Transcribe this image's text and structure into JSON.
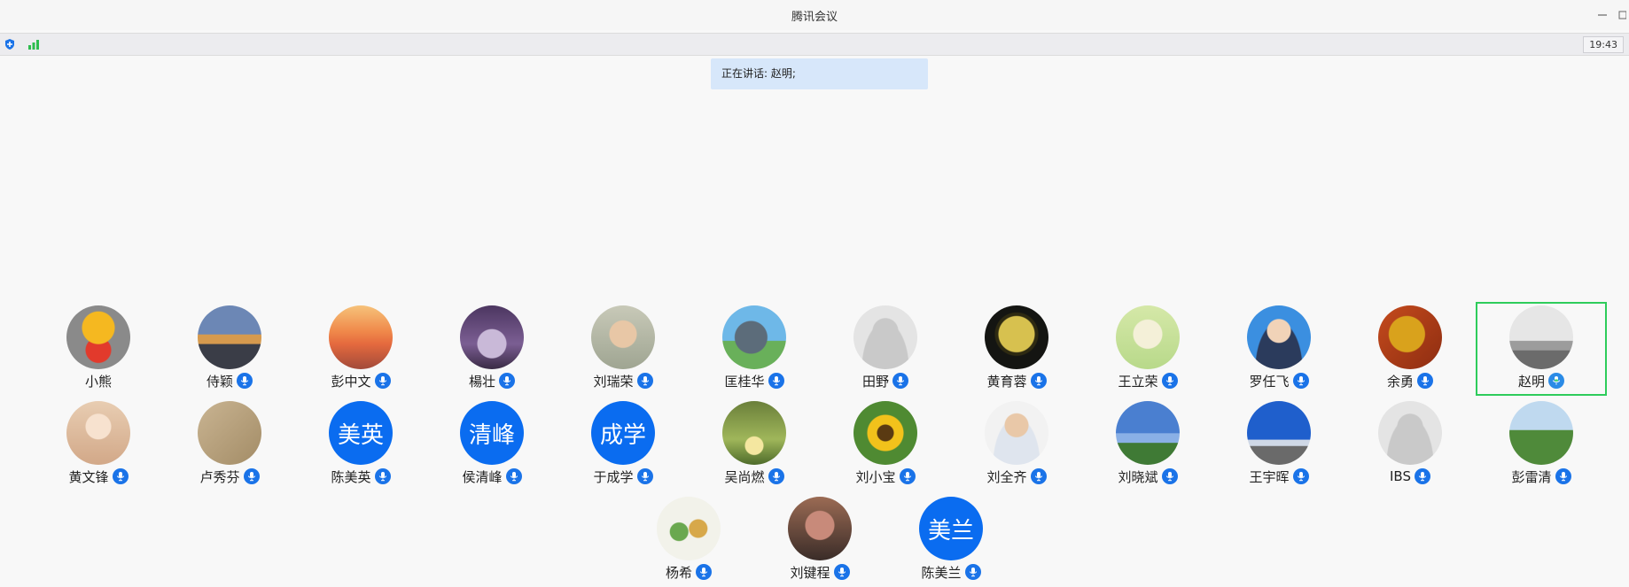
{
  "window": {
    "title": "腾讯会议",
    "minimize_icon": "minimize-icon",
    "restore_icon": "restore-icon"
  },
  "statusbar": {
    "shield_icon": "shield-icon",
    "signal_icon": "signal-icon",
    "time": "19:43"
  },
  "banner": {
    "text": "正在讲话: 赵明;"
  },
  "colors": {
    "accent": "#0a6cf0",
    "active_border": "#2ecc5b",
    "banner_bg": "#d7e7fa"
  },
  "participants": [
    {
      "name": "小熊",
      "avatar": "bear-photo",
      "mic": false
    },
    {
      "name": "侍颖",
      "avatar": "city-photo",
      "mic": true
    },
    {
      "name": "彭中文",
      "avatar": "sunset-photo",
      "mic": true
    },
    {
      "name": "楊壮",
      "avatar": "stage-photo",
      "mic": true
    },
    {
      "name": "刘瑞荣",
      "avatar": "portrait-woman-photo",
      "mic": true
    },
    {
      "name": "匡桂华",
      "avatar": "totoro-photo",
      "mic": true
    },
    {
      "name": "田野",
      "avatar": "default-avatar",
      "mic": true
    },
    {
      "name": "黄育蓉",
      "avatar": "night-building-photo",
      "mic": true
    },
    {
      "name": "王立荣",
      "avatar": "anime-photo",
      "mic": true
    },
    {
      "name": "罗任飞",
      "avatar": "portrait-man-photo",
      "mic": true
    },
    {
      "name": "余勇",
      "avatar": "helmet-photo",
      "mic": true
    },
    {
      "name": "赵明",
      "avatar": "sea-photo",
      "mic": true,
      "speaking": true
    },
    {
      "name": "黄文锋",
      "avatar": "girl-photo",
      "mic": true
    },
    {
      "name": "卢秀芬",
      "avatar": "sand-photo",
      "mic": true
    },
    {
      "name": "陈美英",
      "avatar_text": "美英",
      "mic": true
    },
    {
      "name": "侯清峰",
      "avatar_text": "清峰",
      "mic": true
    },
    {
      "name": "于成学",
      "avatar_text": "成学",
      "mic": true
    },
    {
      "name": "吴尚燃",
      "avatar": "park-photo",
      "mic": true
    },
    {
      "name": "刘小宝",
      "avatar": "sunflower-photo",
      "mic": true
    },
    {
      "name": "刘全齐",
      "avatar": "portrait-man2-photo",
      "mic": true
    },
    {
      "name": "刘晓斌",
      "avatar": "sky-tree-photo",
      "mic": true
    },
    {
      "name": "王宇晖",
      "avatar": "road-sky-photo",
      "mic": true,
      "mic_solid": true
    },
    {
      "name": "IBS",
      "avatar": "default-avatar",
      "mic": true
    },
    {
      "name": "彭雷清",
      "avatar": "green-field-photo",
      "mic": true
    },
    {
      "name": "杨希",
      "avatar": "illustration-photo",
      "mic": true
    },
    {
      "name": "刘键程",
      "avatar": "figurine-photo",
      "mic": true
    },
    {
      "name": "陈美兰",
      "avatar_text": "美兰",
      "mic": true
    }
  ]
}
